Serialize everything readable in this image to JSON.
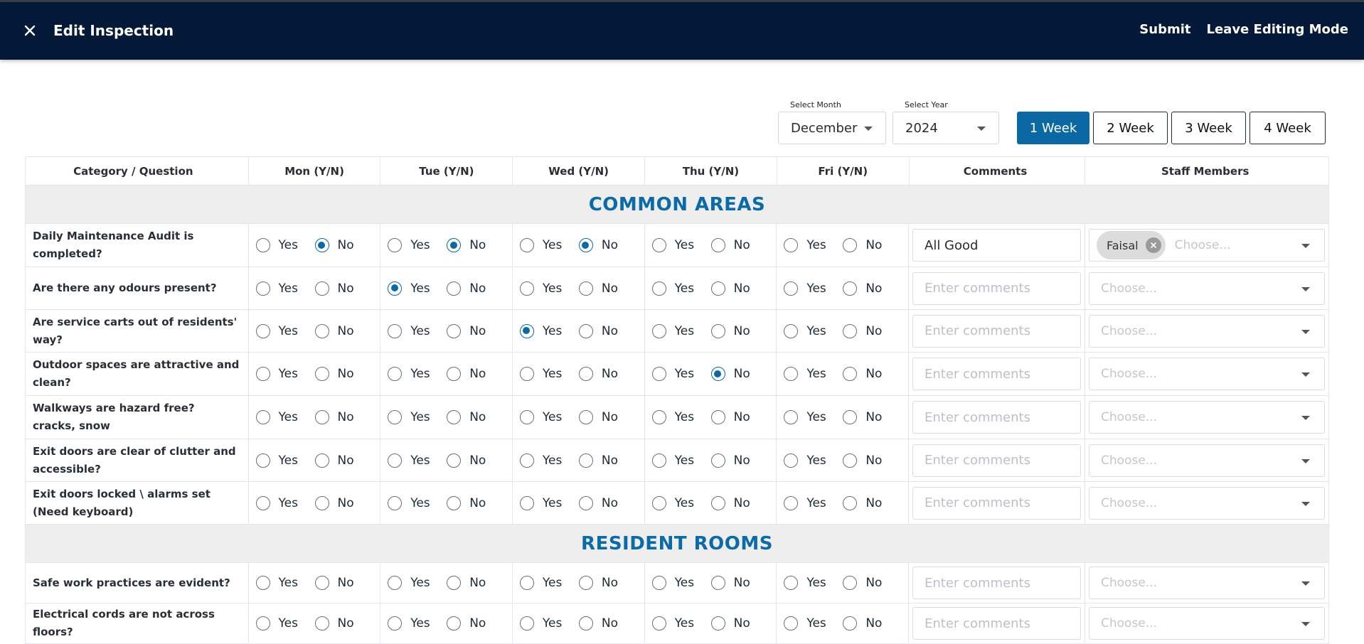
{
  "app": {
    "title": "Edit Inspection",
    "actions": {
      "submit": "Submit",
      "leave": "Leave Editing Mode"
    }
  },
  "filters": {
    "month_label": "Select Month",
    "month_value": "December",
    "year_label": "Select Year",
    "year_value": "2024",
    "weeks": [
      "1 Week",
      "2 Week",
      "3 Week",
      "4 Week"
    ],
    "active_week": "1 Week"
  },
  "table": {
    "headers": [
      "Category / Question",
      "Mon (Y/N)",
      "Tue (Y/N)",
      "Wed (Y/N)",
      "Thu (Y/N)",
      "Fri (Y/N)",
      "Comments",
      "Staff Members"
    ],
    "yes_label": "Yes",
    "no_label": "No",
    "comment_placeholder": "Enter comments",
    "staff_placeholder": "Choose...",
    "categories": [
      {
        "name": "COMMON AREAS",
        "questions": [
          {
            "text": "Daily Maintenance Audit is completed?",
            "answers": [
              "No",
              "No",
              "No",
              "",
              ""
            ],
            "comment": "All Good",
            "staff": [
              "Faisal"
            ]
          },
          {
            "text": "Are there any odours present?",
            "answers": [
              "",
              "Yes",
              "",
              "",
              ""
            ],
            "comment": "",
            "staff": []
          },
          {
            "text": "Are service carts out of residents' way?",
            "answers": [
              "",
              "",
              "Yes",
              "",
              ""
            ],
            "comment": "",
            "staff": []
          },
          {
            "text": "Outdoor spaces are attractive and clean?",
            "answers": [
              "",
              "",
              "",
              "No",
              ""
            ],
            "comment": "",
            "staff": []
          },
          {
            "text": "Walkways are hazard free? cracks, snow",
            "answers": [
              "",
              "",
              "",
              "",
              ""
            ],
            "comment": "",
            "staff": []
          },
          {
            "text": "Exit doors are clear of clutter and accessible?",
            "answers": [
              "",
              "",
              "",
              "",
              ""
            ],
            "comment": "",
            "staff": []
          },
          {
            "text": "Exit doors locked \\ alarms set (Need keyboard)",
            "answers": [
              "",
              "",
              "",
              "",
              ""
            ],
            "comment": "",
            "staff": []
          }
        ]
      },
      {
        "name": "RESIDENT ROOMS",
        "questions": [
          {
            "text": "Safe work practices are evident?",
            "answers": [
              "",
              "",
              "",
              "",
              ""
            ],
            "comment": "",
            "staff": []
          },
          {
            "text": "Electrical cords are not across floors?",
            "answers": [
              "",
              "",
              "",
              "",
              ""
            ],
            "comment": "",
            "staff": []
          }
        ]
      }
    ]
  },
  "colors": {
    "appbar": "#031937",
    "accent": "#0b68a3",
    "category_text": "#0b6aa8",
    "category_bg": "#eeeeee"
  },
  "icons": {
    "close": "close-icon",
    "dropdown": "chevron-down-icon",
    "chip_remove": "remove-chip-icon"
  }
}
